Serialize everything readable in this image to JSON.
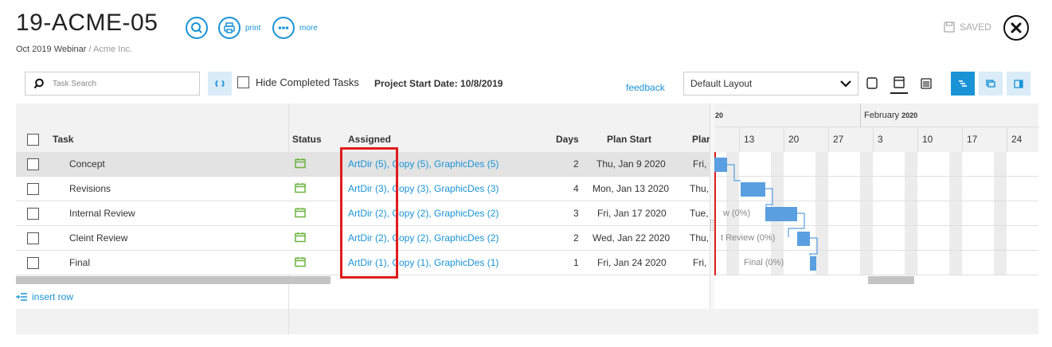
{
  "header": {
    "title": "19-ACME-05",
    "subtitle_project": "Oct 2019 Webinar",
    "subtitle_separator": " / ",
    "subtitle_client": "Acme Inc.",
    "print_label": "print",
    "more_label": "more",
    "saved_label": "SAVED"
  },
  "toolbar": {
    "search_placeholder": "Task Search",
    "hide_completed_label": "Hide Completed Tasks",
    "project_start_label": "Project Start Date: 10/8/2019",
    "feedback_label": "feedback",
    "layout_selected": "Default Layout"
  },
  "grid": {
    "columns": {
      "task": "Task",
      "status": "Status",
      "assigned": "Assigned",
      "days": "Days",
      "plan_start": "Plan Start",
      "plan_end": "Plar"
    },
    "rows": [
      {
        "task": "Concept",
        "assigned": "ArtDir (5), Copy (5), GraphicDes (5)",
        "days": "2",
        "plan_start": "Thu, Jan 9 2020",
        "plan_end": "Fri,"
      },
      {
        "task": "Revisions",
        "assigned": "ArtDir (3), Copy (3), GraphicDes (3)",
        "days": "4",
        "plan_start": "Mon, Jan 13 2020",
        "plan_end": "Thu,"
      },
      {
        "task": "Internal Review",
        "assigned": "ArtDir (2), Copy (2), GraphicDes (2)",
        "days": "3",
        "plan_start": "Fri, Jan 17 2020",
        "plan_end": "Tue,"
      },
      {
        "task": "Cleint Review",
        "assigned": "ArtDir (2), Copy (2), GraphicDes (2)",
        "days": "2",
        "plan_start": "Wed, Jan 22 2020",
        "plan_end": "Thu,"
      },
      {
        "task": "Final",
        "assigned": "ArtDir (1), Copy (1), GraphicDes (1)",
        "days": "1",
        "plan_start": "Fri, Jan 24 2020",
        "plan_end": "Fri,"
      }
    ],
    "insert_row_label": "insert row"
  },
  "gantt": {
    "month_left": "20",
    "month_right": "February",
    "month_right_year": "2020",
    "days": [
      "13",
      "20",
      "27",
      "3",
      "10",
      "17",
      "24"
    ],
    "labels": [
      "w (0%)",
      "t Review (0%)",
      "Final (0%)"
    ]
  },
  "colors": {
    "accent": "#1a93d6",
    "bar": "#5a9fe0",
    "status_icon": "#6cb33f",
    "highlight": "#e01b1b"
  }
}
